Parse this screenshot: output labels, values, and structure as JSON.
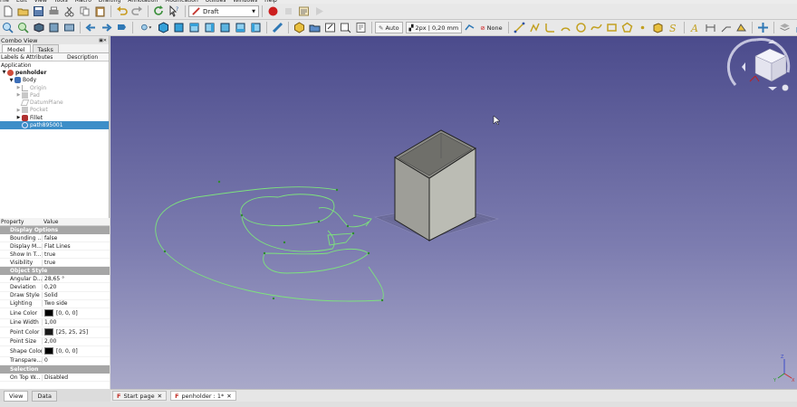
{
  "menu": [
    "File",
    "Edit",
    "View",
    "Tools",
    "Macro",
    "Drafting",
    "Annotation",
    "Modification",
    "Utilities",
    "Windows",
    "Help"
  ],
  "toolbar": {
    "workbench": "Draft",
    "construction_auto": "Auto",
    "line_style": "2px | 0,20 mm",
    "snap_none": "None"
  },
  "combo": {
    "title": "Combo View",
    "tabs": [
      "Model",
      "Tasks"
    ],
    "columns": [
      "Labels & Attributes",
      "Description"
    ],
    "application": "Application",
    "tree": [
      {
        "label": "penholder",
        "level": 1,
        "state": "doc"
      },
      {
        "label": "Body",
        "level": 2,
        "state": "normal"
      },
      {
        "label": "Origin",
        "level": 3,
        "state": "dim"
      },
      {
        "label": "Pad",
        "level": 3,
        "state": "dim"
      },
      {
        "label": "DatumPlane",
        "level": 3,
        "state": "dim"
      },
      {
        "label": "Pocket",
        "level": 3,
        "state": "dim"
      },
      {
        "label": "Fillet",
        "level": 3,
        "state": "normal"
      },
      {
        "label": "path895001",
        "level": 2,
        "state": "selected"
      }
    ]
  },
  "properties": {
    "columns": [
      "Property",
      "Value"
    ],
    "groups": [
      {
        "name": "Display Options",
        "rows": [
          {
            "name": "Bounding ...",
            "value": "false"
          },
          {
            "name": "Display M...",
            "value": "Flat Lines"
          },
          {
            "name": "Show In T...",
            "value": "true"
          },
          {
            "name": "Visibility",
            "value": "true"
          }
        ]
      },
      {
        "name": "Object Style",
        "rows": [
          {
            "name": "Angular D...",
            "value": "28,65 °"
          },
          {
            "name": "Deviation",
            "value": "0,20"
          },
          {
            "name": "Draw Style",
            "value": "Solid"
          },
          {
            "name": "Lighting",
            "value": "Two side"
          },
          {
            "name": "Line Color",
            "value": "[0, 0, 0]",
            "swatch": "#000000"
          },
          {
            "name": "Line Width",
            "value": "1,00"
          },
          {
            "name": "Point Color",
            "value": "[25, 25, 25]",
            "swatch": "#191919"
          },
          {
            "name": "Point Size",
            "value": "2,00"
          },
          {
            "name": "Shape Color",
            "value": "[0, 0, 0]",
            "swatch": "#000000"
          },
          {
            "name": "Transpare...",
            "value": "0"
          }
        ]
      },
      {
        "name": "Selection",
        "rows": [
          {
            "name": "On Top W...",
            "value": "Disabled"
          }
        ]
      }
    ]
  },
  "bottom_tabs": [
    "View",
    "Data"
  ],
  "doc_tabs": [
    {
      "label": "Start page",
      "active": false
    },
    {
      "label": "penholder : 1*",
      "active": true
    }
  ],
  "colors": {
    "viewport_top": "#4b4b8c",
    "viewport_bottom": "#a9a9c9",
    "sketch_green": "#7de27d",
    "box_face": "#9e9e98",
    "selection": "#3d8ec8"
  }
}
